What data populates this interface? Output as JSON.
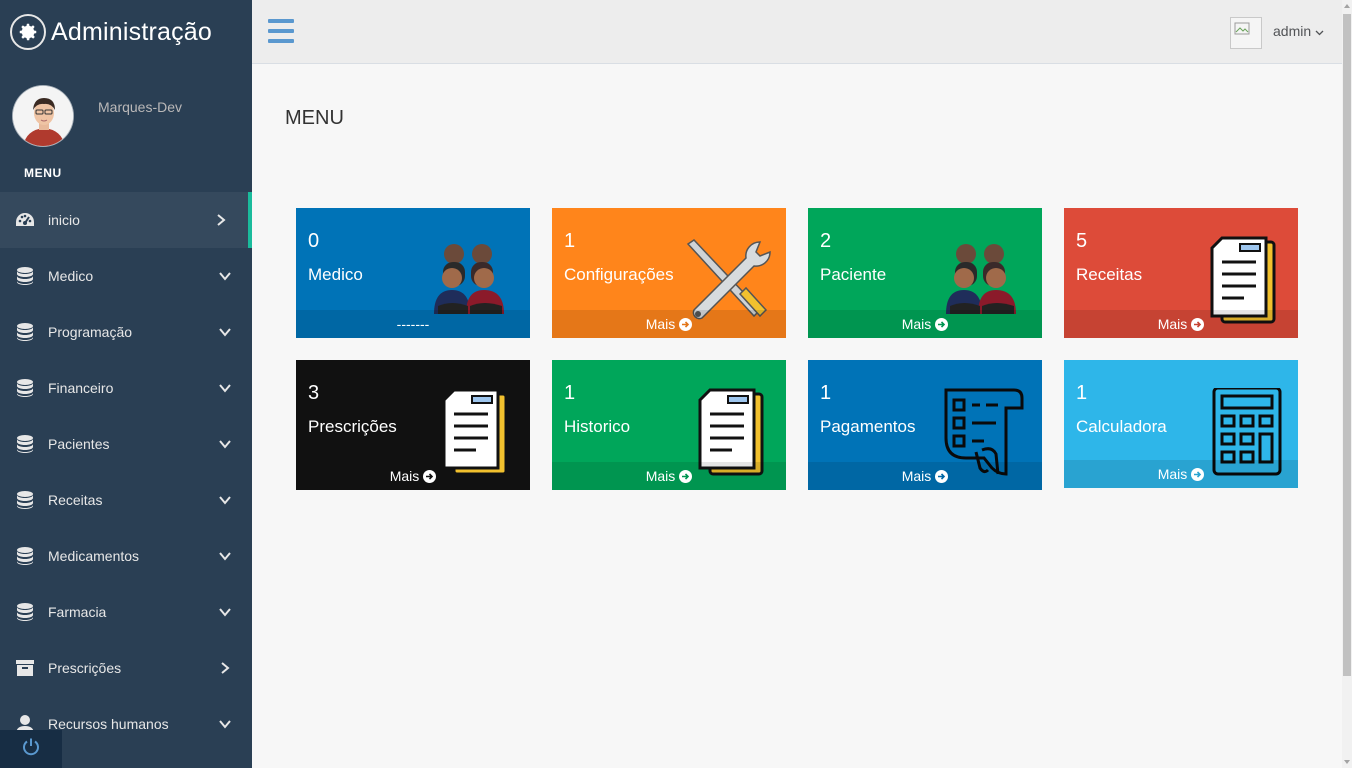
{
  "sidebar": {
    "brand_title": "Administração",
    "profile_name": "Marques-Dev",
    "section_label": "MENU",
    "items": [
      {
        "label": "inicio",
        "icon": "dashboard-icon",
        "arrow": "chevron-right"
      },
      {
        "label": "Medico",
        "icon": "database-icon",
        "arrow": "chevron-down"
      },
      {
        "label": "Programação",
        "icon": "database-icon",
        "arrow": "chevron-down"
      },
      {
        "label": "Financeiro",
        "icon": "database-icon",
        "arrow": "chevron-down"
      },
      {
        "label": "Pacientes",
        "icon": "database-icon",
        "arrow": "chevron-down"
      },
      {
        "label": "Receitas",
        "icon": "database-icon",
        "arrow": "chevron-down"
      },
      {
        "label": "Medicamentos",
        "icon": "database-icon",
        "arrow": "chevron-down"
      },
      {
        "label": "Farmacia",
        "icon": "database-icon",
        "arrow": "chevron-down"
      },
      {
        "label": "Prescrições",
        "icon": "archive-icon",
        "arrow": "chevron-right"
      },
      {
        "label": "Recursos humanos",
        "icon": "user-icon",
        "arrow": "chevron-down"
      }
    ]
  },
  "topbar": {
    "user": "admin"
  },
  "main": {
    "title": "MENU",
    "tiles": [
      {
        "count": "0",
        "label": "Medico",
        "footer": "-------",
        "color": "#0073b7",
        "art": "people-icon"
      },
      {
        "count": "1",
        "label": "Configurações",
        "footer": "Mais",
        "color": "#ff851b",
        "art": "tools-icon"
      },
      {
        "count": "2",
        "label": "Paciente",
        "footer": "Mais",
        "color": "#00a65a",
        "art": "people-icon"
      },
      {
        "count": "5",
        "label": "Receitas",
        "footer": "Mais",
        "color": "#dd4b39",
        "art": "document-icon"
      },
      {
        "count": "3",
        "label": "Prescrições",
        "footer": "Mais",
        "color": "#111111",
        "art": "document-icon"
      },
      {
        "count": "1",
        "label": "Historico",
        "footer": "Mais",
        "color": "#00a65a",
        "art": "document-icon"
      },
      {
        "count": "1",
        "label": "Pagamentos",
        "footer": "Mais",
        "color": "#0073b7",
        "art": "checklist-icon"
      },
      {
        "count": "1",
        "label": "Calculadora",
        "footer": "Mais",
        "color": "#2eb6e9",
        "art": "calculator-icon"
      }
    ]
  }
}
